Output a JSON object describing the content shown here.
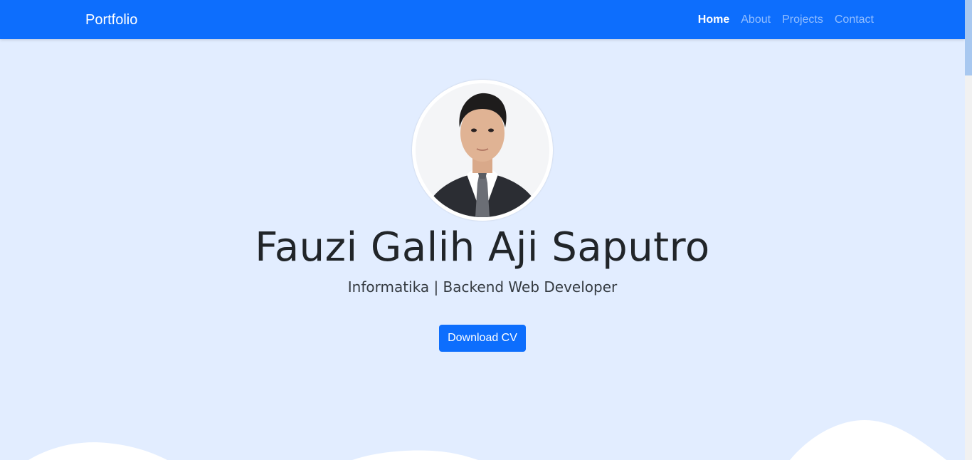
{
  "navbar": {
    "brand": "Portfolio",
    "items": [
      {
        "label": "Home",
        "active": true
      },
      {
        "label": "About",
        "active": false
      },
      {
        "label": "Projects",
        "active": false
      },
      {
        "label": "Contact",
        "active": false
      }
    ]
  },
  "hero": {
    "name": "Fauzi Galih Aji Saputro",
    "subtitle": "Informatika | Backend Web Developer",
    "button_label": "Download CV"
  },
  "colors": {
    "primary": "#0d6efd",
    "background": "#e2edff",
    "wave": "#ffffff"
  }
}
